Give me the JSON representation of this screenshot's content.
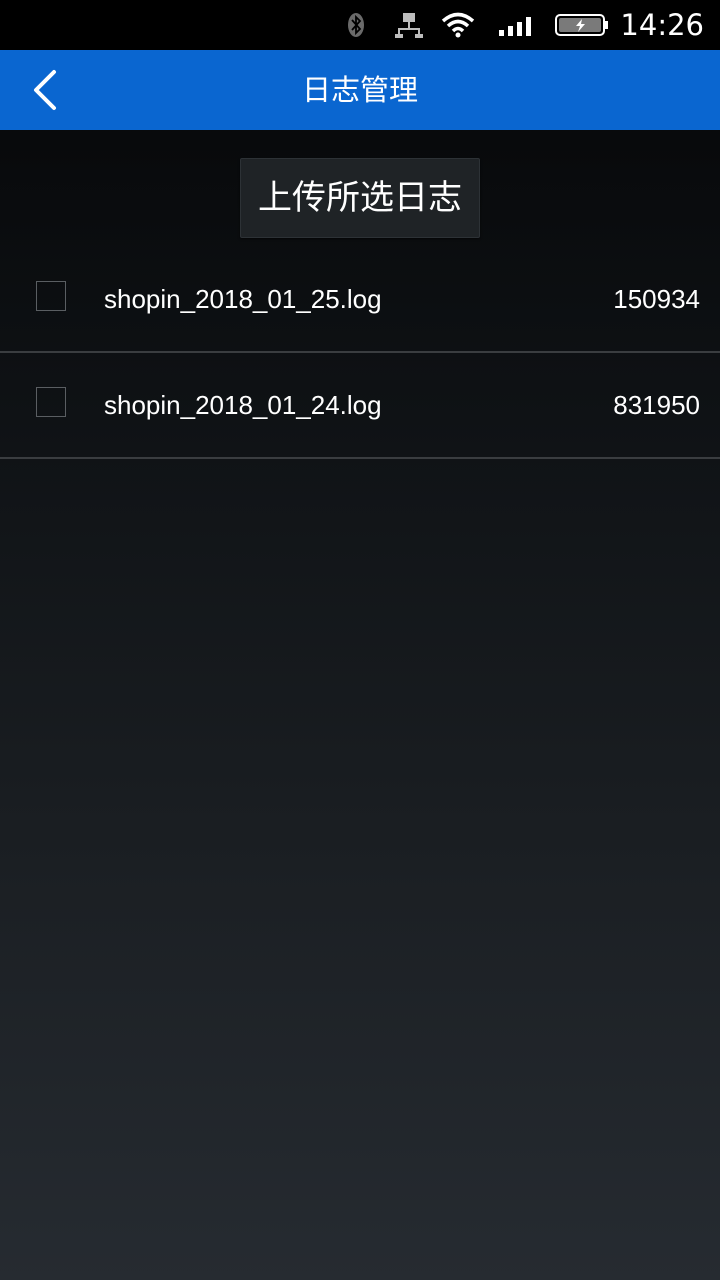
{
  "status_bar": {
    "time": "14:26",
    "icons": [
      "bluetooth-icon",
      "network-icon",
      "wifi-icon",
      "signal-icon",
      "battery-charging-icon"
    ]
  },
  "header": {
    "title": "日志管理",
    "back_icon": "chevron-left-icon"
  },
  "actions": {
    "upload_label": "上传所选日志"
  },
  "files": [
    {
      "name": "shopin_2018_01_25.log",
      "size": "150934",
      "checked": false
    },
    {
      "name": "shopin_2018_01_24.log",
      "size": "831950",
      "checked": false
    }
  ],
  "colors": {
    "header_bg": "#0a66d0",
    "status_bg": "#000000",
    "divider": "#3a3d40"
  }
}
